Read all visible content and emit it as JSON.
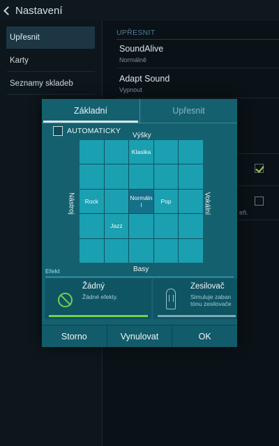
{
  "actionbar": {
    "title": "Nastavení"
  },
  "sidebar": {
    "items": [
      {
        "label": "Upřesnit",
        "selected": true
      },
      {
        "label": "Karty",
        "selected": false
      },
      {
        "label": "Seznamy skladeb",
        "selected": false
      }
    ]
  },
  "settings": {
    "section_header": "UPŘESNIT",
    "items": [
      {
        "title": "SoundAlive",
        "subtitle": "Normálně"
      },
      {
        "title": "Adapt Sound",
        "subtitle": "Vypnout"
      }
    ],
    "checkbox_1_checked": true,
    "checkbox_2_checked": false,
    "peek_text": "eň."
  },
  "dialog": {
    "tabs": [
      {
        "label": "Základní",
        "active": true
      },
      {
        "label": "Upřesnit",
        "active": false
      }
    ],
    "auto": {
      "label": "AUTOMATICKY",
      "checked": false
    },
    "axes": {
      "top": "Výšky",
      "bottom": "Basy",
      "left": "Nástroj",
      "right": "Vokální"
    },
    "grid": {
      "size": 5,
      "labels": {
        "klasika": "Klasika",
        "rock": "Rock",
        "normal": "Normální",
        "pop": "Pop",
        "jazz": "Jazz"
      },
      "selected": "Normální"
    },
    "effects": {
      "header": "Efekt",
      "cards": [
        {
          "title": "Žádný",
          "subtitle": "Žádné efekty.",
          "icon": "no-effect-icon",
          "active": true
        },
        {
          "title": "Zesilovač",
          "subtitle_line1": "Simuluje zaban",
          "subtitle_line2": "tónu zesilovače",
          "icon": "amplifier-tube-icon",
          "active": false
        }
      ]
    },
    "buttons": {
      "cancel": "Storno",
      "reset": "Vynulovat",
      "ok": "OK"
    }
  },
  "colors": {
    "accent_green": "#74d24a",
    "dialog_bg": "#15606f",
    "grid_cell": "#1aa0b1",
    "grid_selected": "#15708a",
    "effect_header": "#6dc6e0"
  }
}
